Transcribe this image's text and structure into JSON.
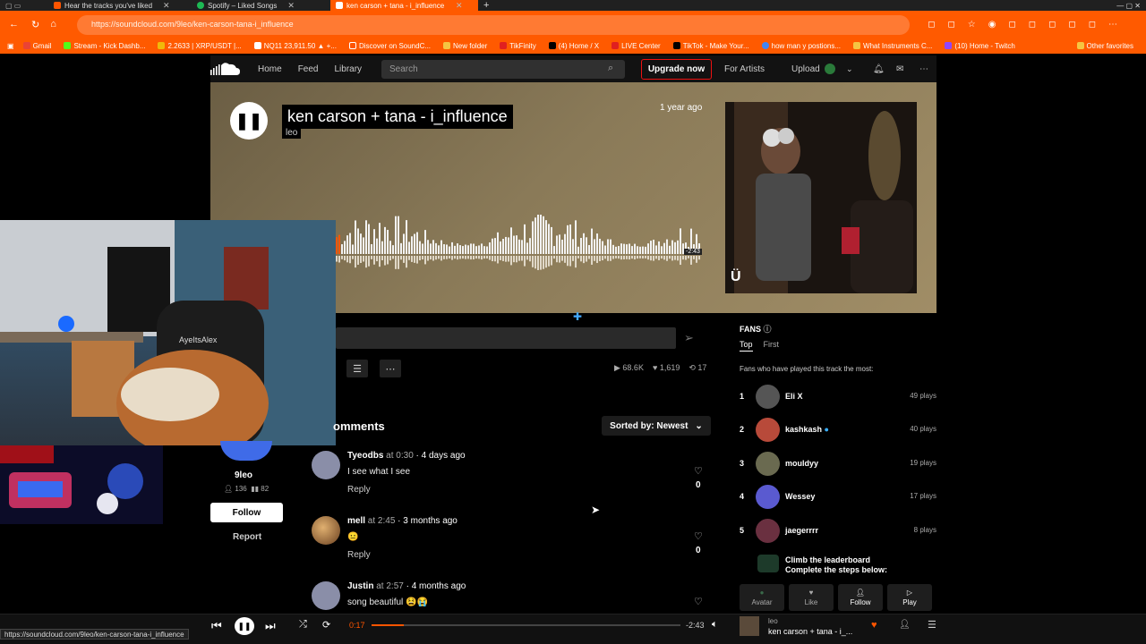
{
  "browser": {
    "tabs": [
      {
        "label": "Hear the tracks you've liked",
        "color": "#ff5500"
      },
      {
        "label": "Spotify – Liked Songs",
        "color": "#1db954"
      },
      {
        "label": "ken carson + tana - i_influence",
        "color": "#ff5500"
      }
    ],
    "url": "https://soundcloud.com/9leo/ken-carson-tana-i_influence",
    "bookmarks": [
      {
        "label": "Gmail",
        "color": "#ea4335"
      },
      {
        "label": "Stream - Kick Dashb...",
        "color": "#53fc18"
      },
      {
        "label": "2.2633 | XRP/USDT |...",
        "color": "#f0b90b"
      },
      {
        "label": "NQ11 23,911.50 ▲ +...",
        "color": "#ffffff"
      },
      {
        "label": "Discover on SoundC...",
        "color": "#ff5500"
      },
      {
        "label": "New folder",
        "color": "#f5c542"
      },
      {
        "label": "TikFinity",
        "color": "#e02020"
      },
      {
        "label": "(4) Home / X",
        "color": "#000000"
      },
      {
        "label": "LIVE Center",
        "color": "#e02020"
      },
      {
        "label": "TikTok - Make Your...",
        "color": "#000000"
      },
      {
        "label": "how man y postions...",
        "color": "#4285f4"
      },
      {
        "label": "What Instruments C...",
        "color": "#f5c542"
      },
      {
        "label": "(10) Home - Twitch",
        "color": "#9146ff"
      }
    ],
    "other_favorites": "Other favorites",
    "status_url": "https://soundcloud.com/9leo/ken-carson-tana-i_influence"
  },
  "nav": {
    "home": "Home",
    "feed": "Feed",
    "library": "Library",
    "search_placeholder": "Search",
    "upgrade": "Upgrade now",
    "for_artists": "For Artists",
    "upload": "Upload"
  },
  "track": {
    "title": "ken carson + tana - i_influence",
    "artist": "leo",
    "posted": "1 year ago",
    "remaining": "-2:43",
    "plays": "68.6K",
    "likes": "1,619",
    "reposts": "17"
  },
  "webcam": {
    "name": "AyeItsAlex"
  },
  "uploader": {
    "name": "9leo",
    "followers": "136",
    "tracks": "82",
    "follow": "Follow",
    "report": "Report"
  },
  "comments_section": {
    "title": "omments",
    "sort": "Sorted by: Newest",
    "items": [
      {
        "user": "Tyeodbs",
        "at": " at ",
        "time": "0:30",
        "ago": " · 4 days ago",
        "text": "I see what I see",
        "reply": "Reply",
        "likes": "0",
        "avatar_color": "#8a8ea8"
      },
      {
        "user": "mell",
        "at": " at ",
        "time": "2:45",
        "ago": " · 3 months ago",
        "text": "😐",
        "reply": "Reply",
        "likes": "0",
        "avatar_color": "#c8a060"
      },
      {
        "user": "Justin",
        "at": " at ",
        "time": "2:57",
        "ago": " · 4 months ago",
        "text": "song beautiful 😫😭",
        "reply": "Reply",
        "likes": "",
        "avatar_color": "#8a8ea8"
      }
    ]
  },
  "fans": {
    "header": "FANS",
    "tab_top": "Top",
    "tab_first": "First",
    "subtitle": "Fans who have played this track the most:",
    "list": [
      {
        "rank": "1",
        "name": "Eli X",
        "plays": "49 plays",
        "color": "#555"
      },
      {
        "rank": "2",
        "name": "kashkash",
        "plays": "40 plays",
        "color": "#b84a3a"
      },
      {
        "rank": "3",
        "name": "mouldyy",
        "plays": "19 plays",
        "color": "#6a6a50"
      },
      {
        "rank": "4",
        "name": "Wessey",
        "plays": "17 plays",
        "color": "#5a5ad0"
      },
      {
        "rank": "5",
        "name": "jaegerrrr",
        "plays": "8 plays",
        "color": "#6a3040"
      }
    ],
    "climb_title": "Climb the leaderboard",
    "climb_sub": "Complete the steps below:",
    "steps": [
      "Avatar",
      "Like",
      "Follow",
      "Play"
    ]
  },
  "player": {
    "elapsed": "0:17",
    "remaining": "-2:43",
    "progress": 0.105,
    "mini_artist": "leo",
    "mini_title": "ken carson + tana - i_..."
  }
}
